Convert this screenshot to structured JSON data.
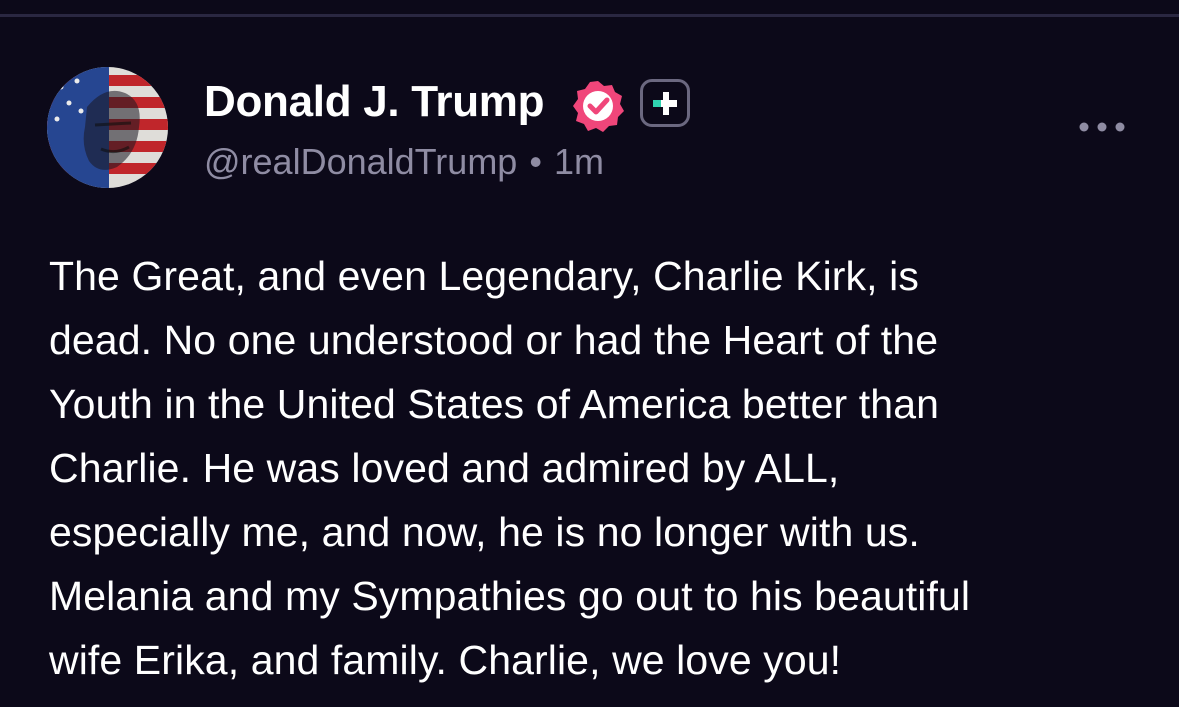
{
  "post": {
    "author": {
      "display_name": "Donald J. Trump",
      "handle": "@realDonaldTrump",
      "verified_icon": "verified-badge-icon",
      "badge_icon": "plus-badge-icon",
      "avatar": "avatar-image"
    },
    "separator": "•",
    "timestamp": "1m",
    "more_icon": "more-options-icon",
    "body_lines": [
      "The Great, and even Legendary, Charlie Kirk, is",
      "dead. No one understood or had the Heart of the",
      "Youth in the United States of America better than",
      "Charlie. He was loved and admired by ALL,",
      "especially me, and now, he is no longer with us.",
      "Melania and my Sympathies go out to his beautiful",
      "wife Erika, and family. Charlie, we love you!"
    ]
  },
  "colors": {
    "background": "#0c0919",
    "text": "#ffffff",
    "muted_text": "#8f8ca3",
    "verified_pink": "#f0467a",
    "plus_accent": "#2fd3b0",
    "divider": "#2a2741"
  }
}
